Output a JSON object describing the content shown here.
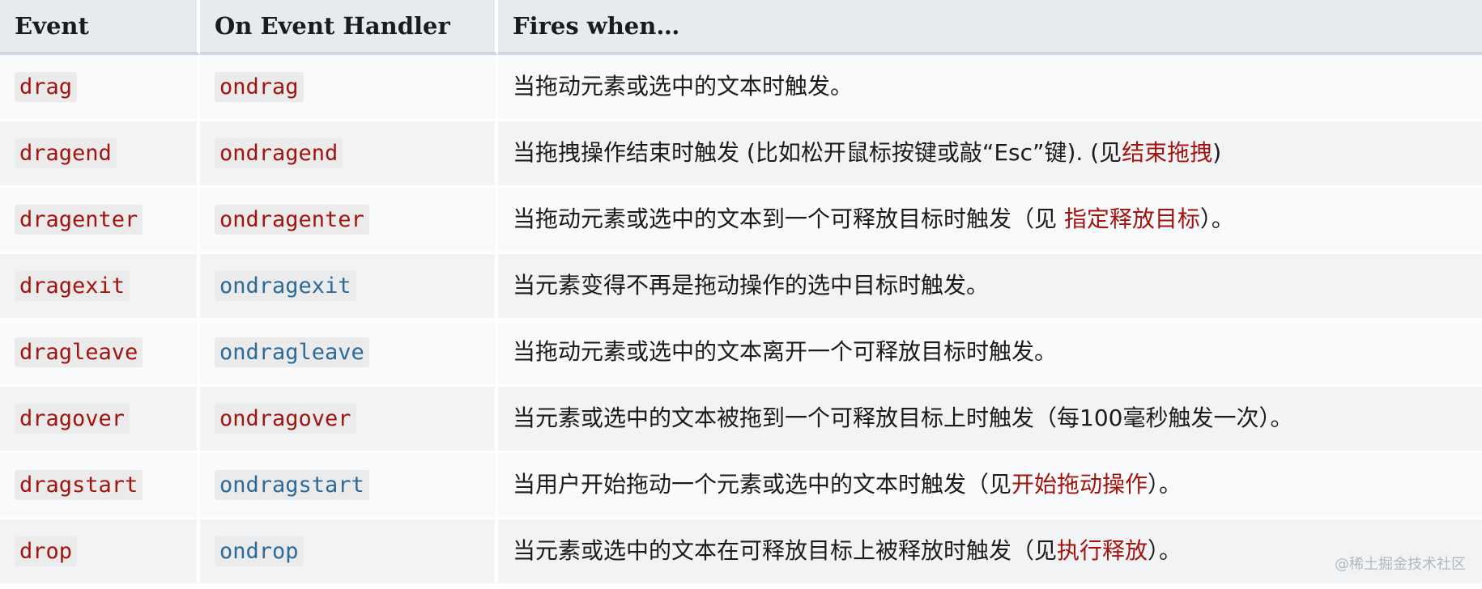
{
  "headers": {
    "event": "Event",
    "handler": "On Event Handler",
    "fires": "Fires when…"
  },
  "rows": [
    {
      "event": "drag",
      "handler": "ondrag",
      "handler_color": "red",
      "desc_before": "当拖动元素或选中的文本时触发。",
      "desc_link": "",
      "desc_after": ""
    },
    {
      "event": "dragend",
      "handler": "ondragend",
      "handler_color": "red",
      "desc_before": "当拖拽操作结束时触发 (比如松开鼠标按键或敲“Esc”键). (见",
      "desc_link": "结束拖拽",
      "desc_after": ")"
    },
    {
      "event": "dragenter",
      "handler": "ondragenter",
      "handler_color": "red",
      "desc_before": "当拖动元素或选中的文本到一个可释放目标时触发（见 ",
      "desc_link": "指定释放目标",
      "desc_after": "）。"
    },
    {
      "event": "dragexit",
      "handler": "ondragexit",
      "handler_color": "blue",
      "desc_before": "当元素变得不再是拖动操作的选中目标时触发。",
      "desc_link": "",
      "desc_after": ""
    },
    {
      "event": "dragleave",
      "handler": "ondragleave",
      "handler_color": "blue",
      "desc_before": "当拖动元素或选中的文本离开一个可释放目标时触发。",
      "desc_link": "",
      "desc_after": ""
    },
    {
      "event": "dragover",
      "handler": "ondragover",
      "handler_color": "red",
      "desc_before": "当元素或选中的文本被拖到一个可释放目标上时触发（每100毫秒触发一次）。",
      "desc_link": "",
      "desc_after": ""
    },
    {
      "event": "dragstart",
      "handler": "ondragstart",
      "handler_color": "blue",
      "desc_before": "当用户开始拖动一个元素或选中的文本时触发（见",
      "desc_link": "开始拖动操作",
      "desc_after": "）。"
    },
    {
      "event": "drop",
      "handler": "ondrop",
      "handler_color": "blue",
      "desc_before": "当元素或选中的文本在可释放目标上被释放时触发（见",
      "desc_link": "执行释放",
      "desc_after": "）。"
    }
  ],
  "colors": {
    "code_red": "#a1140f",
    "code_blue": "#2c6a99",
    "header_bg": "#e8ebee"
  },
  "watermark": "@稀土掘金技术社区"
}
